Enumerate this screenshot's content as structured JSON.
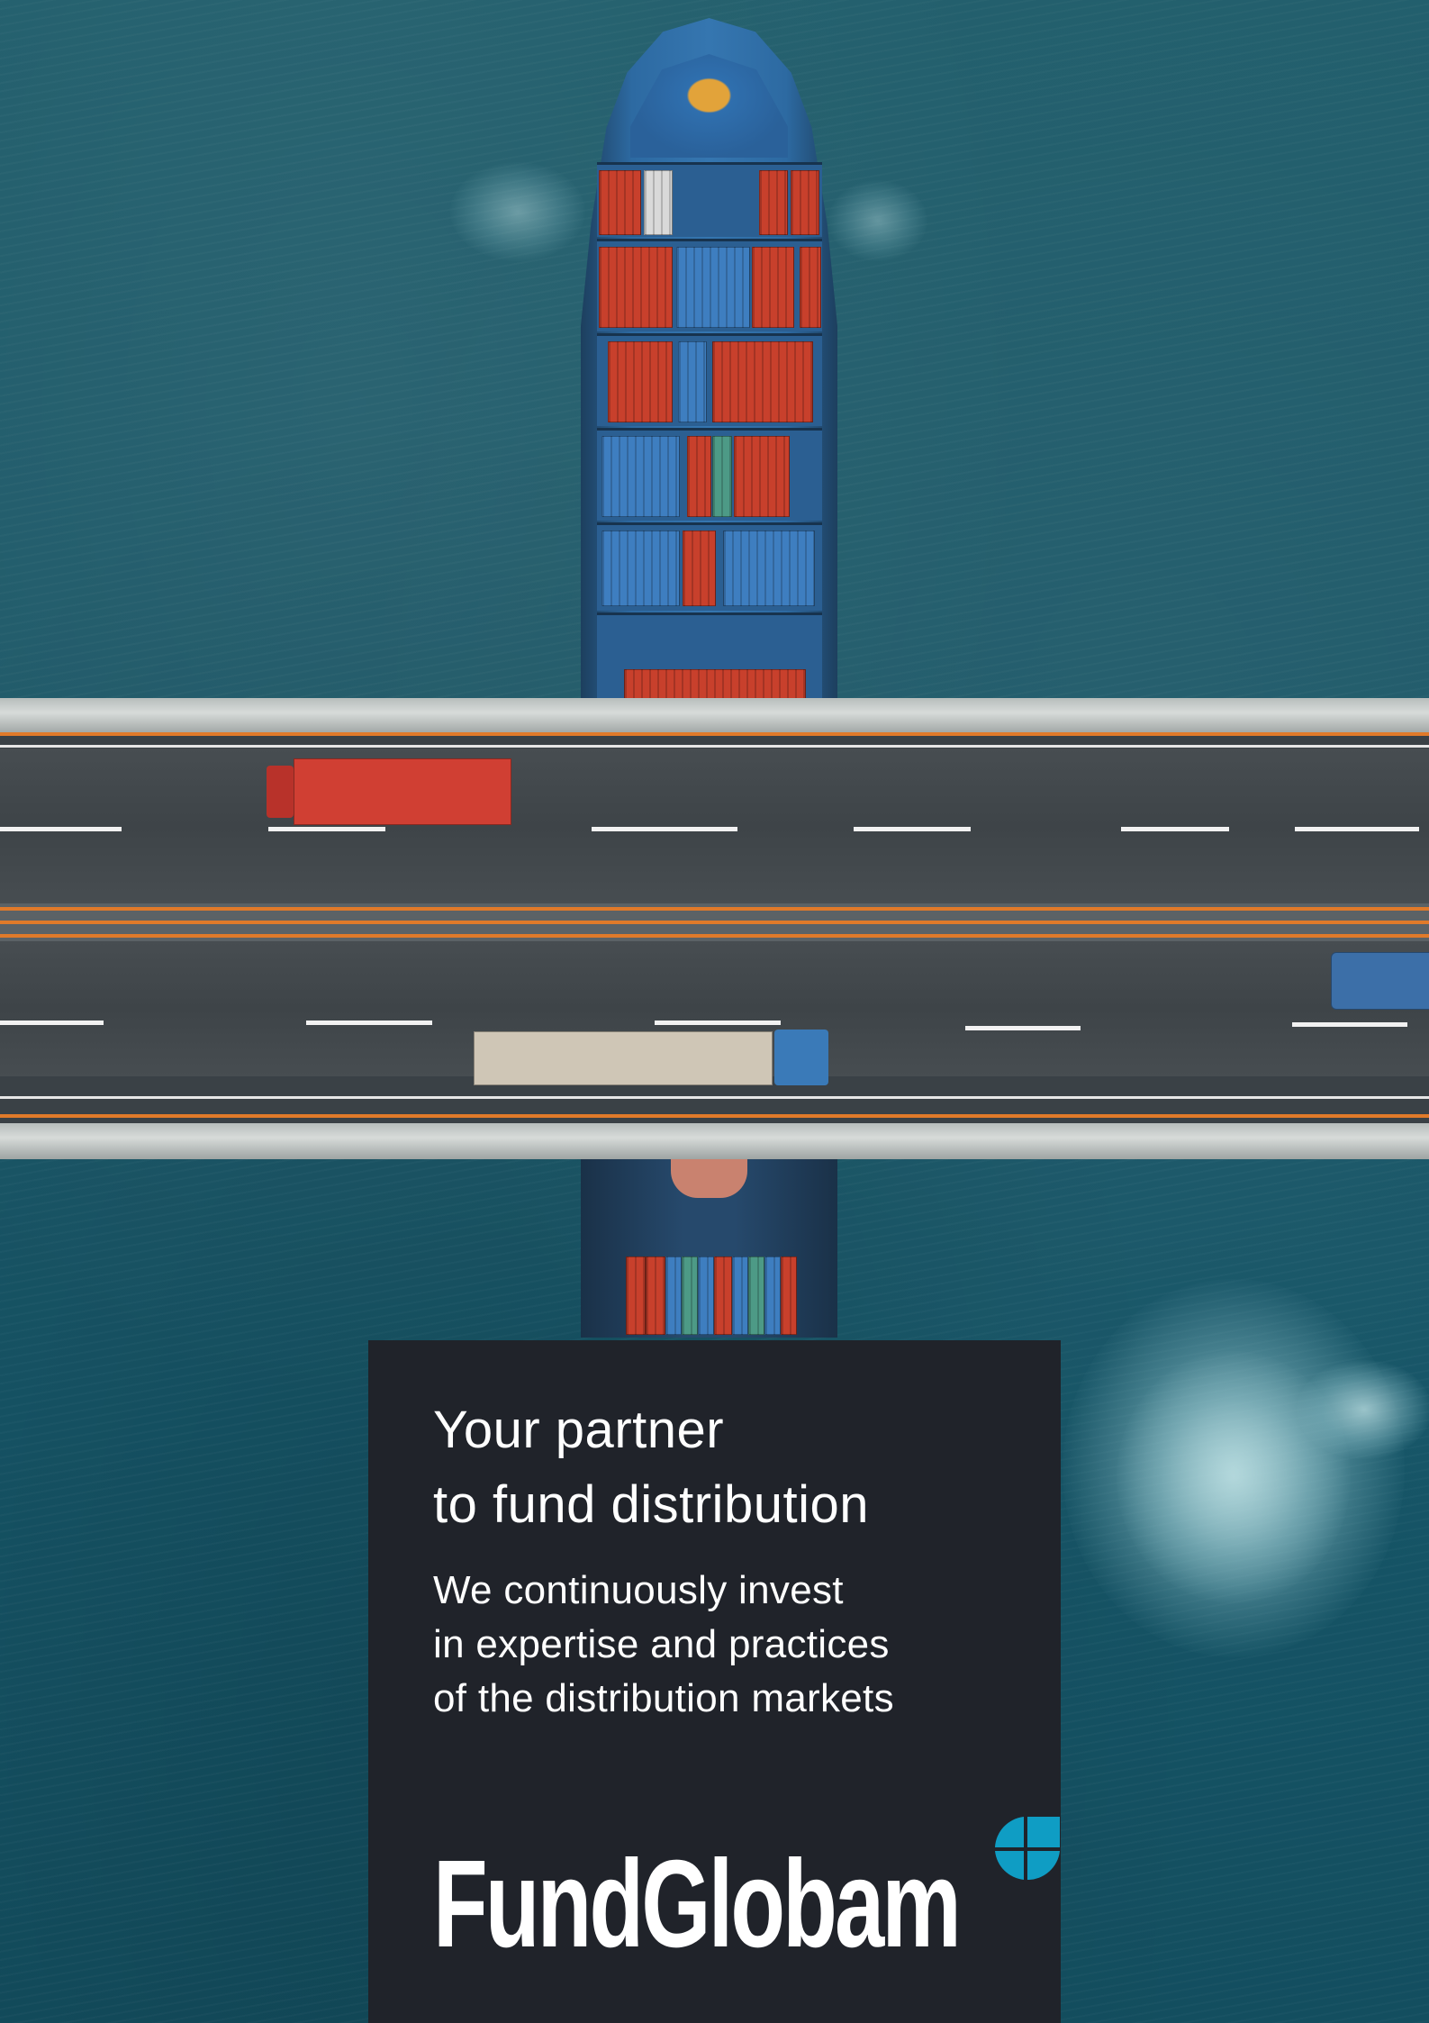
{
  "ad": {
    "headline_line1": "Your partner",
    "headline_line2": "to fund distribution",
    "sub_line1": "We continuously invest",
    "sub_line2": "in expertise and practices",
    "sub_line3": "of the distribution markets"
  },
  "brand": {
    "name": "FundGlobam",
    "logo_mark_icon": "globe-quadrant-icon",
    "accent_color": "#0f9dc4",
    "card_color": "#20232a"
  }
}
